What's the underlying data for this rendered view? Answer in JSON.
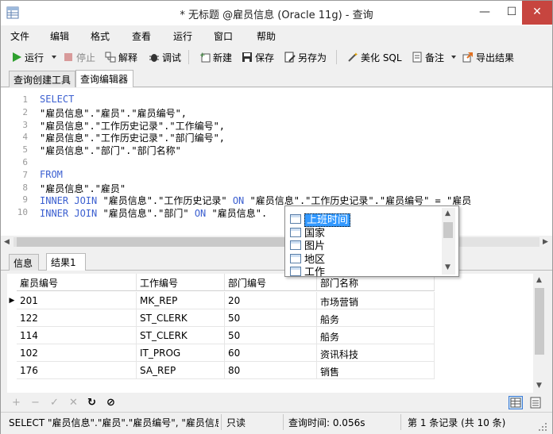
{
  "window": {
    "title": "* 无标题 @雇员信息 (Oracle 11g) - 查询"
  },
  "menu": [
    "文件",
    "编辑",
    "格式",
    "查看",
    "运行",
    "窗口",
    "帮助"
  ],
  "toolbar": {
    "run": "运行",
    "stop": "停止",
    "explain": "解释",
    "debug": "调试",
    "new": "新建",
    "save": "保存",
    "save_as": "另存为",
    "beautify": "美化 SQL",
    "comment": "备注",
    "export": "导出结果"
  },
  "tabs": [
    "查询创建工具",
    "查询编辑器"
  ],
  "editor": {
    "lines": [
      {
        "n": "1",
        "parts": [
          {
            "t": "SELECT",
            "k": true
          }
        ]
      },
      {
        "n": "2",
        "parts": [
          {
            "t": "\"雇员信息\".\"雇员\".\"雇员编号\","
          }
        ]
      },
      {
        "n": "3",
        "parts": [
          {
            "t": "\"雇员信息\".\"工作历史记录\".\"工作编号\","
          }
        ]
      },
      {
        "n": "4",
        "parts": [
          {
            "t": "\"雇员信息\".\"工作历史记录\".\"部门编号\","
          }
        ]
      },
      {
        "n": "5",
        "parts": [
          {
            "t": "\"雇员信息\".\"部门\".\"部门名称\""
          }
        ]
      },
      {
        "n": "6",
        "parts": [
          {
            "t": ""
          }
        ]
      },
      {
        "n": "7",
        "parts": [
          {
            "t": "FROM",
            "k": true
          }
        ]
      },
      {
        "n": "8",
        "parts": [
          {
            "t": "\"雇员信息\".\"雇员\""
          }
        ]
      },
      {
        "n": "9",
        "parts": [
          {
            "t": "INNER JOIN",
            "k": true
          },
          {
            "t": " \"雇员信息\".\"工作历史记录\" "
          },
          {
            "t": "ON",
            "k": true
          },
          {
            "t": " \"雇员信息\".\"工作历史记录\".\"雇员编号\" = \"雇员"
          }
        ]
      },
      {
        "n": "10",
        "parts": [
          {
            "t": "INNER JOIN",
            "k": true
          },
          {
            "t": " \"雇员信息\".\"部门\" "
          },
          {
            "t": "ON",
            "k": true
          },
          {
            "t": " \"雇员信息\"."
          }
        ]
      }
    ]
  },
  "autocomplete": {
    "items": [
      "上班时间",
      "国家",
      "图片",
      "地区",
      "工作"
    ],
    "selected": 0
  },
  "result_tabs": [
    "信息",
    "结果1"
  ],
  "grid": {
    "columns": [
      "雇员编号",
      "工作编号",
      "部门编号",
      "部门名称"
    ],
    "rows": [
      [
        "201",
        "MK_REP",
        "20",
        "市场营销"
      ],
      [
        "122",
        "ST_CLERK",
        "50",
        "船务"
      ],
      [
        "114",
        "ST_CLERK",
        "50",
        "船务"
      ],
      [
        "102",
        "IT_PROG",
        "60",
        "资讯科技"
      ],
      [
        "176",
        "SA_REP",
        "80",
        "销售"
      ]
    ],
    "current_row": 0
  },
  "gridnav": {
    "add": "+",
    "remove": "−",
    "apply": "✓",
    "discard": "✕",
    "refresh": "↻",
    "stop": "⊘"
  },
  "status": {
    "sql": "SELECT \"雇员信息\".\"雇员\".\"雇员编号\", \"雇员信息",
    "mode": "只读",
    "query_time": "查询时间: 0.056s",
    "records": "第 1 条记录 (共 10 条)"
  },
  "colors": {
    "keyword": "#3b5fd0",
    "selection": "#3399ff",
    "close": "#c7453f"
  }
}
